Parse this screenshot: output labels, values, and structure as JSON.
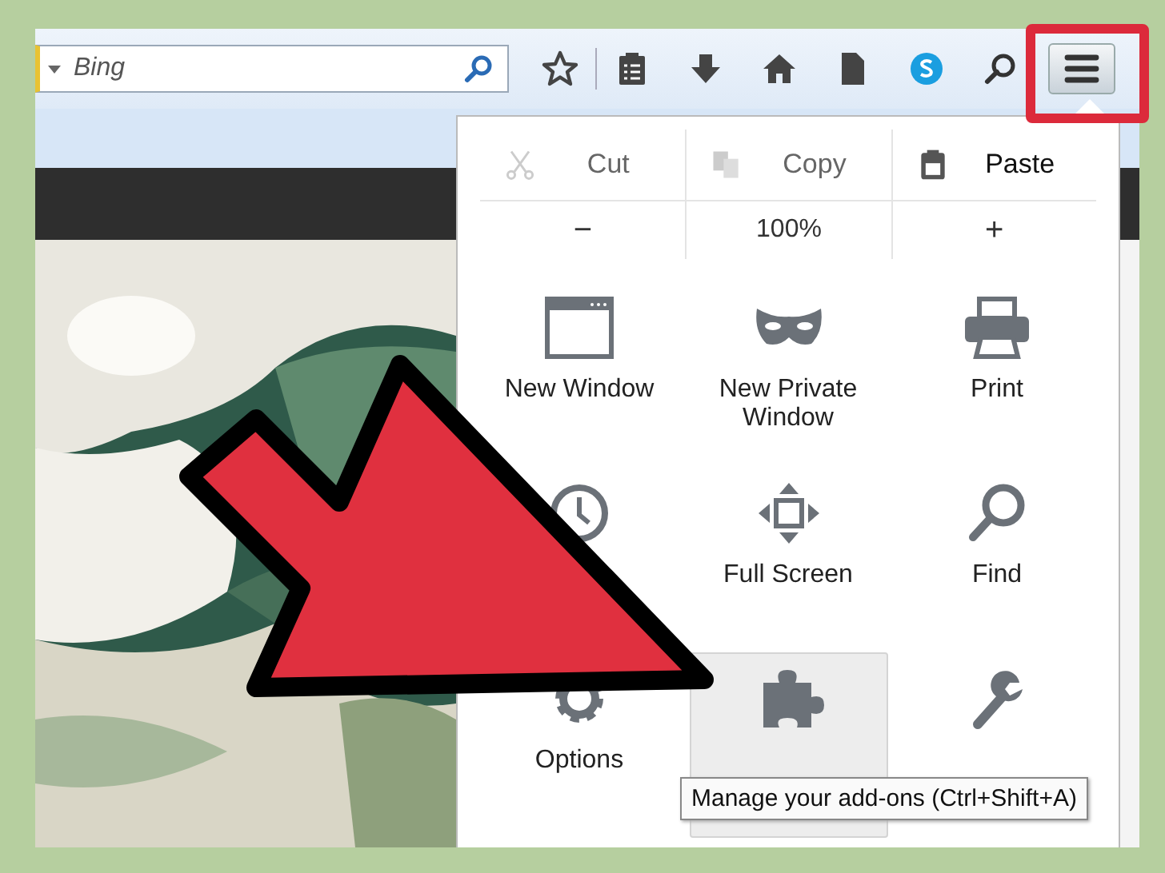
{
  "search": {
    "placeholder": "Bing"
  },
  "toolbar_icons": [
    {
      "kind": "star"
    },
    {
      "kind": "reading-list"
    },
    {
      "kind": "download"
    },
    {
      "kind": "home"
    },
    {
      "kind": "page"
    },
    {
      "kind": "chat"
    },
    {
      "kind": "search"
    }
  ],
  "menu_button": {
    "highlighted": true
  },
  "edit_row": [
    {
      "kind": "cut",
      "label": "Cut",
      "disabled": true
    },
    {
      "kind": "copy",
      "label": "Copy",
      "disabled": true
    },
    {
      "kind": "paste",
      "label": "Paste",
      "disabled": false
    }
  ],
  "zoom_row": {
    "decrease": "−",
    "level": "100%",
    "increase": "+"
  },
  "items": [
    {
      "kind": "window",
      "label": "New Window",
      "hovered": false
    },
    {
      "kind": "mask",
      "label": "New Private Window",
      "hovered": false
    },
    {
      "kind": "printer",
      "label": "Print",
      "hovered": false
    },
    {
      "kind": "clock",
      "hovered": false
    },
    {
      "kind": "fullscreen",
      "label": "Full Screen",
      "hovered": false
    },
    {
      "kind": "magnifier",
      "label": "Find",
      "hovered": false
    },
    {
      "kind": "gear",
      "label": "Options",
      "hovered": false
    },
    {
      "kind": "puzzle",
      "hovered": true
    },
    {
      "kind": "wrench",
      "hovered": false
    }
  ],
  "tooltip": "Manage your add-ons (Ctrl+Shift+A)"
}
